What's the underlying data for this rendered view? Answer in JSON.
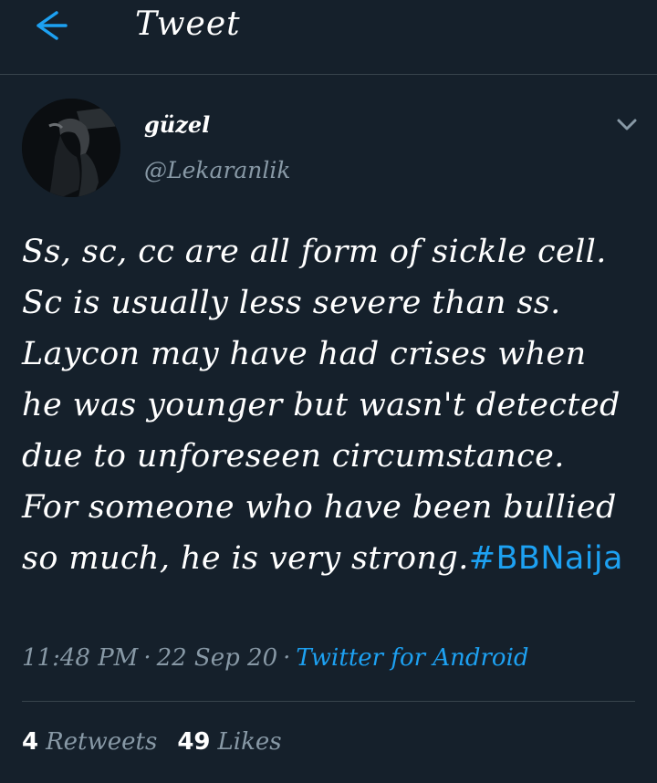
{
  "header": {
    "back_icon": "arrow-left-icon",
    "title": "Tweet"
  },
  "author": {
    "display_name": "güzel",
    "handle": "@Lekaranlik",
    "menu_icon": "chevron-down-icon"
  },
  "tweet": {
    "text": "Ss, sc, cc are all form of sickle cell.  Sc is usually less severe than ss. Laycon may have had crises when he was younger but wasn't detected due to unforeseen circumstance.  For someone who have been bullied so much, he is very strong.",
    "hashtag": "#BBNaija",
    "time": "11:48 PM",
    "date": "22 Sep 20",
    "separator": "·",
    "source": "Twitter for Android"
  },
  "stats": {
    "retweets_count": "4",
    "retweets_label": "Retweets",
    "likes_count": "49",
    "likes_label": "Likes"
  },
  "colors": {
    "background": "#15202b",
    "accent": "#1da1f2",
    "muted": "#8899a6",
    "divider": "#38444d"
  }
}
